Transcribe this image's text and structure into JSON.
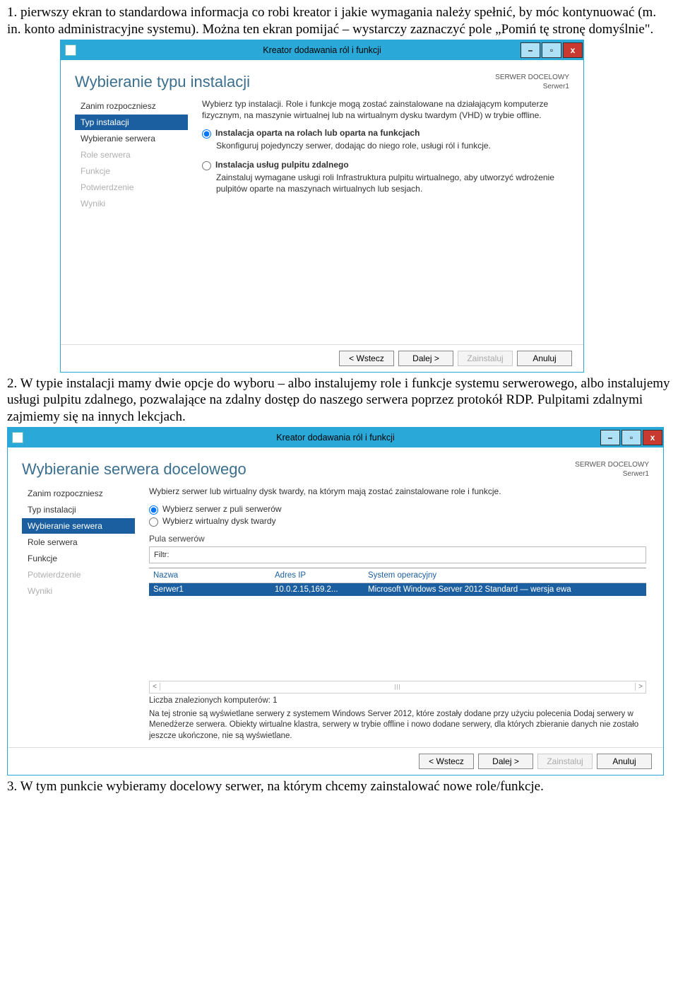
{
  "doc": {
    "para1": "1. pierwszy ekran to standardowa informacja co robi kreator i jakie wymagania należy spełnić, by móc kontynuować (m. in. konto administracyjne systemu). Można ten ekran pomijać – wystarczy zaznaczyć pole „Pomiń tę stronę domyślnie\".",
    "para2": "2. W typie instalacji mamy dwie opcje do wyboru – albo instalujemy role i funkcje systemu serwerowego, albo instalujemy usługi pulpitu zdalnego, pozwalające na zdalny dostęp do naszego serwera poprzez protokół RDP. Pulpitami zdalnymi zajmiemy się na innych lekcjach.",
    "para3": "3. W tym punkcie wybieramy docelowy serwer, na którym chcemy zainstalować nowe role/funkcje."
  },
  "w1": {
    "title": "Kreator dodawania ról i funkcji",
    "heading": "Wybieranie typu instalacji",
    "target_label": "SERWER DOCELOWY",
    "target_value": "Serwer1",
    "intro": "Wybierz typ instalacji. Role i funkcje mogą zostać zainstalowane na działającym komputerze fizycznym, na maszynie wirtualnej lub na wirtualnym dysku twardym (VHD) w trybie offline.",
    "opt1_label": "Instalacja oparta na rolach lub oparta na funkcjach",
    "opt1_desc": "Skonfiguruj pojedynczy serwer, dodając do niego role, usługi ról i funkcje.",
    "opt2_label": "Instalacja usług pulpitu zdalnego",
    "opt2_desc": "Zainstaluj wymagane usługi roli Infrastruktura pulpitu wirtualnego, aby utworzyć wdrożenie pulpitów oparte na maszynach wirtualnych lub sesjach.",
    "sidebar": {
      "i0": "Zanim rozpoczniesz",
      "i1": "Typ instalacji",
      "i2": "Wybieranie serwera",
      "i3": "Role serwera",
      "i4": "Funkcje",
      "i5": "Potwierdzenie",
      "i6": "Wyniki"
    }
  },
  "w2": {
    "title": "Kreator dodawania ról i funkcji",
    "heading": "Wybieranie serwera docelowego",
    "target_label": "SERWER DOCELOWY",
    "target_value": "Serwer1",
    "intro": "Wybierz serwer lub wirtualny dysk twardy, na którym mają zostać zainstalowane role i funkcje.",
    "opt1_label": "Wybierz serwer z puli serwerów",
    "opt2_label": "Wybierz wirtualny dysk twardy",
    "pool_label": "Pula serwerów",
    "filter_label": "Filtr:",
    "col1": "Nazwa",
    "col2": "Adres IP",
    "col3": "System operacyjny",
    "row_name": "Serwer1",
    "row_ip": "10.0.2.15,169.2...",
    "row_os": "Microsoft Windows Server 2012 Standard — wersja ewa",
    "count": "Liczba znalezionych komputerów: 1",
    "note": "Na tej stronie są wyświetlane serwery z systemem Windows Server 2012, które zostały dodane przy użyciu polecenia Dodaj serwery w Menedżerze serwera. Obiekty wirtualne klastra, serwery w trybie offline i nowo dodane serwery, dla których zbieranie danych nie zostało jeszcze ukończone, nie są wyświetlane.",
    "sidebar": {
      "i0": "Zanim rozpoczniesz",
      "i1": "Typ instalacji",
      "i2": "Wybieranie serwera",
      "i3": "Role serwera",
      "i4": "Funkcje",
      "i5": "Potwierdzenie",
      "i6": "Wyniki"
    }
  },
  "buttons": {
    "back": "< Wstecz",
    "next": "Dalej >",
    "install": "Zainstaluj",
    "cancel": "Anuluj"
  }
}
